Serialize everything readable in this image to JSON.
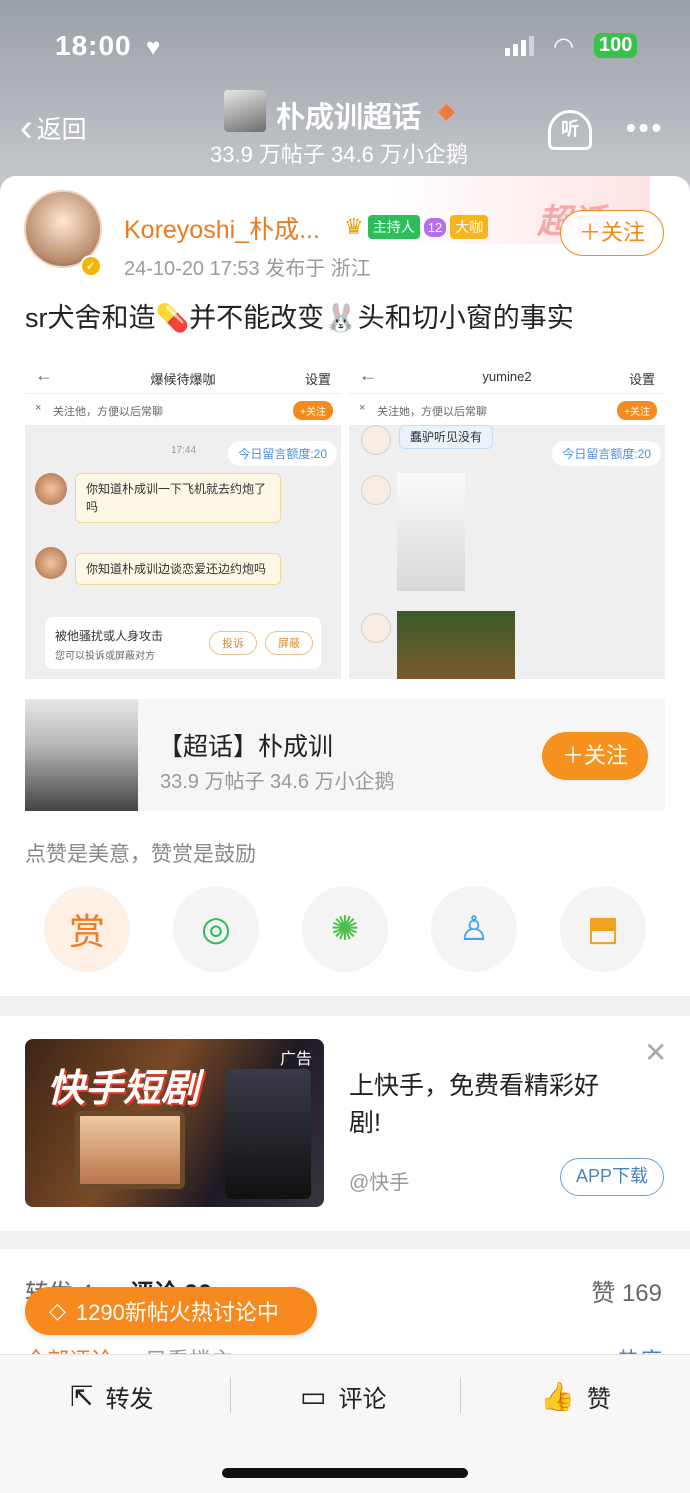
{
  "status": {
    "time": "18:00",
    "battery": "100"
  },
  "nav": {
    "back_label": "返回",
    "title": "朴成训超话",
    "subtitle": "33.9 万帖子 34.6 万小企鹅",
    "listen_label": "听"
  },
  "post": {
    "username": "Koreyoshi_朴成...",
    "badges": {
      "host": "主持人",
      "level": "12",
      "big": "大咖"
    },
    "follow_label": "＋关注",
    "meta": "24-10-20 17:53  发布于 浙江",
    "text": "sr犬舍和造💊并不能改变🐰头和切小窗的事实",
    "deco_text": "超话",
    "shot1": {
      "title": "爆候待爆咖",
      "settings": "设置",
      "notice": "关注他，方便以后常聊",
      "follow": "+关注",
      "time": "17:44",
      "quota": "今日留言额度:20",
      "msg1": "你知道朴成训一下飞机就去约炮了吗",
      "msg2": "你知道朴成训边谈恋爱还边约炮吗",
      "report_title": "被他骚扰或人身攻击",
      "report_sub": "您可以投诉或屏蔽对方",
      "complain": "投诉",
      "block": "屏蔽"
    },
    "shot2": {
      "title": "yumine2",
      "settings": "设置",
      "notice": "关注她，方便以后常聊",
      "follow": "+关注",
      "msg": "蠢驴听见没有",
      "quota": "今日留言额度:20"
    }
  },
  "topic": {
    "title": "【超话】朴成训",
    "stats": "33.9 万帖子 34.6 万小企鹅",
    "follow_label": "＋关注"
  },
  "like_hint": "点赞是美意，赞赏是鼓励",
  "share_actions": [
    {
      "name": "reward",
      "label": "赏"
    },
    {
      "name": "wechat"
    },
    {
      "name": "moments"
    },
    {
      "name": "qq"
    },
    {
      "name": "save-image"
    }
  ],
  "ad": {
    "brand_art": "快手短剧",
    "tag": "广告",
    "title": "上快手，免费看精彩好剧!",
    "source": "@快手",
    "download_label": "APP下载"
  },
  "stats": {
    "forward": "转发 4",
    "comment": "评论 96",
    "likes": "赞 169",
    "all_comments": "全部评论",
    "only_author": "只看楼主",
    "sort": "热度"
  },
  "hot_banner": "1290新帖火热讨论中",
  "bottom_bar": {
    "forward": "转发",
    "comment": "评论",
    "like": "赞"
  },
  "colors": {
    "accent": "#f7891e",
    "username": "#ee7a1e",
    "link": "#4a82c3"
  }
}
